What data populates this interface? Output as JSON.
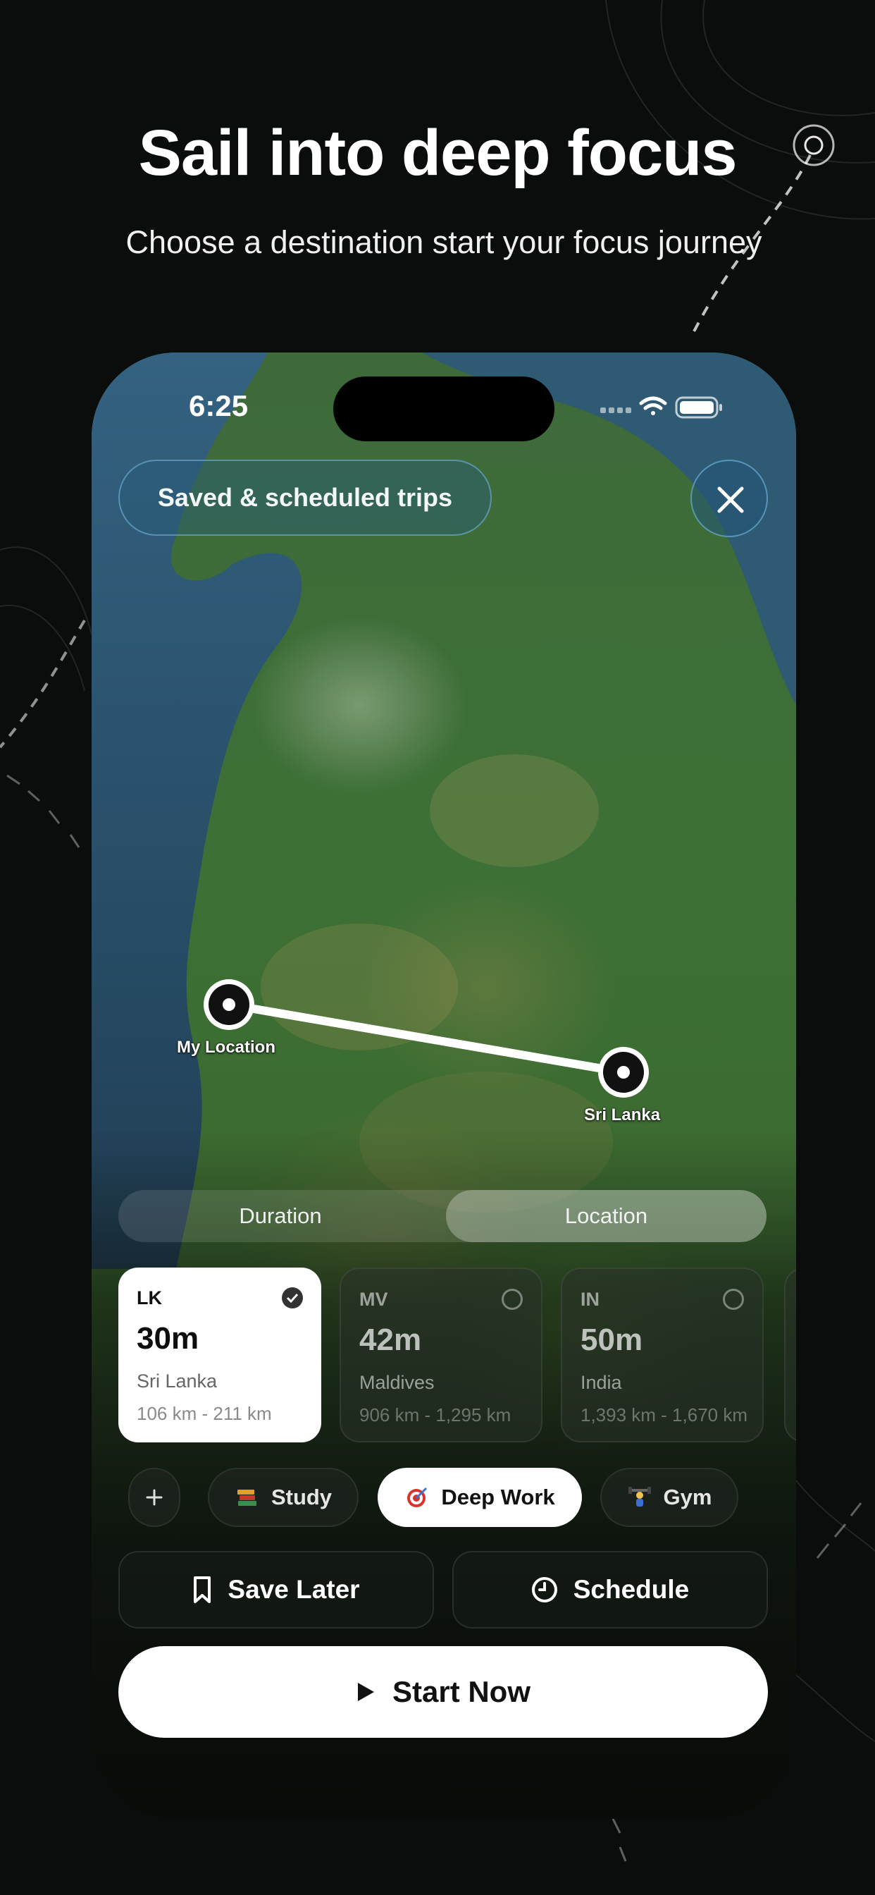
{
  "promo": {
    "headline": "Sail into deep focus",
    "subheadline": "Choose a destination start your focus journey"
  },
  "status_bar": {
    "time": "6:25",
    "icons": [
      "signal-icon",
      "wifi-icon",
      "battery-icon"
    ]
  },
  "top": {
    "trips_label": "Saved & scheduled trips",
    "close_icon": "close-icon"
  },
  "map": {
    "origin_label": "My Location",
    "destination_label": "Sri Lanka"
  },
  "segmented": {
    "duration_label": "Duration",
    "location_label": "Location",
    "selected": "Location"
  },
  "cards": [
    {
      "code": "LK",
      "duration": "30m",
      "country": "Sri Lanka",
      "distance": "106 km - 211 km",
      "selected": true
    },
    {
      "code": "MV",
      "duration": "42m",
      "country": "Maldives",
      "distance": "906 km - 1,295 km",
      "selected": false
    },
    {
      "code": "IN",
      "duration": "50m",
      "country": "India",
      "distance": "1,393 km - 1,670 km",
      "selected": false
    }
  ],
  "tags": {
    "add_icon": "plus-icon",
    "items": [
      {
        "label": "Study",
        "icon": "books-emoji",
        "selected": false
      },
      {
        "label": "Deep Work",
        "icon": "target-emoji",
        "selected": true
      },
      {
        "label": "Gym",
        "icon": "weightlifter-emoji",
        "selected": false
      }
    ]
  },
  "actions": {
    "save_later": "Save Later",
    "schedule": "Schedule",
    "start_now": "Start Now"
  },
  "colors": {
    "background": "#0b0c0c",
    "pill_border": "#78bee6",
    "primary_button": "#ffffff"
  }
}
